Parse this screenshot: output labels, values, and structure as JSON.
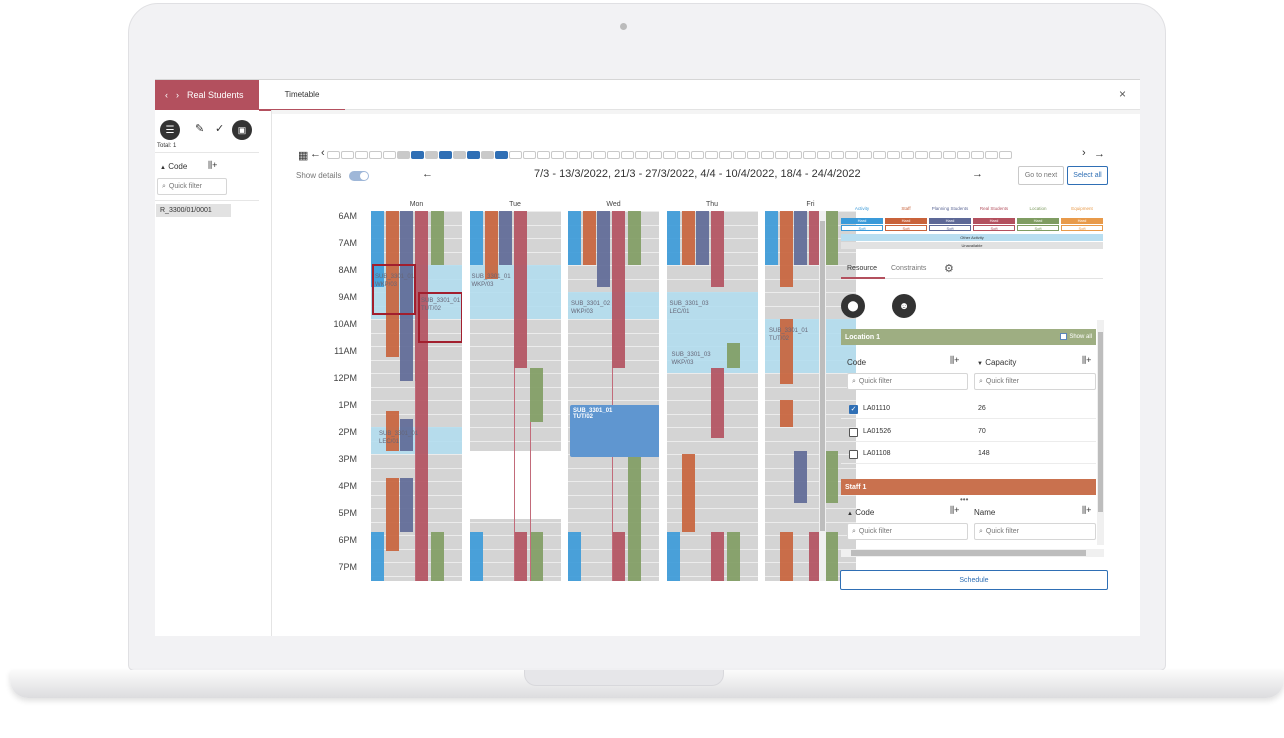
{
  "header": {
    "breadcrumb_label": "Real Students",
    "tab_label": "Timetable",
    "close_icon": "×"
  },
  "left": {
    "total": "Total: 1",
    "code_header": "Code",
    "filter_placeholder": "Quick filter",
    "rows": [
      "R_3300/01/0001"
    ]
  },
  "toolbar": {
    "date_range": "7/3 - 13/3/2022, 21/3 - 27/3/2022, 4/4 - 10/4/2022, 18/4 - 24/4/2022",
    "show_details": "Show details",
    "go_to_next": "Go to next",
    "select_all": "Select all",
    "week_states": [
      0,
      0,
      0,
      0,
      0,
      1,
      2,
      1,
      2,
      1,
      2,
      1,
      2,
      0,
      0,
      0,
      0,
      0,
      0,
      0,
      0,
      0,
      0,
      0,
      0,
      0,
      0,
      0,
      0,
      0,
      0,
      0,
      0,
      0,
      0,
      0,
      0,
      0,
      0,
      0,
      0,
      0,
      0,
      0,
      0,
      0,
      0,
      0,
      0
    ]
  },
  "calendar": {
    "days": [
      "Mon",
      "Tue",
      "Wed",
      "Thu",
      "Fri"
    ],
    "hours": [
      "6AM",
      "7AM",
      "8AM",
      "9AM",
      "10AM",
      "11AM",
      "12PM",
      "1PM",
      "2PM",
      "3PM",
      "4PM",
      "5PM",
      "6PM",
      "7PM"
    ],
    "events": [
      {
        "line1": "SUB_3301_01",
        "line2": "LEC/01"
      },
      {
        "line1": "SUB_3301_01",
        "line2": "TUT/02"
      },
      {
        "line1": "SUB_3301_01",
        "line2": "WKP/03"
      },
      {
        "line1": "SUB_3301_02",
        "line2": "LEC/01"
      },
      {
        "line1": "SUB_3301_02",
        "line2": "WKP/03"
      },
      {
        "line1": "SUB_3301_02",
        "line2": "TUT/02"
      },
      {
        "line1": "SUB_3301_03",
        "line2": "LEC/01"
      },
      {
        "line1": "SUB_3301_03",
        "line2": "WKP/03"
      },
      {
        "line1": "SUB_3301_01",
        "line2": "TUT/02"
      }
    ]
  },
  "legend": {
    "columns": [
      {
        "name": "Activity",
        "color": "#3a9ad9"
      },
      {
        "name": "Staff",
        "color": "#c8623a"
      },
      {
        "name": "Planning Students",
        "color": "#5d6896"
      },
      {
        "name": "Real Students",
        "color": "#b3505e"
      },
      {
        "name": "Location",
        "color": "#7f9c62"
      },
      {
        "name": "Equipment",
        "color": "#e89a4a"
      }
    ],
    "hard": "Hard",
    "soft": "Soft",
    "other_activity": "Other Activity",
    "unavailable": "Unavailable"
  },
  "right": {
    "tabs": [
      "Resource",
      "Constraints"
    ],
    "location_panel": "Location 1",
    "show_all": "Show all",
    "code": "Code",
    "capacity": "Capacity",
    "name": "Name",
    "filter_placeholder": "Quick filter",
    "locations": [
      {
        "code": "LA01110",
        "capacity": "26",
        "checked": true
      },
      {
        "code": "LA01526",
        "capacity": "70",
        "checked": false
      },
      {
        "code": "LA01108",
        "capacity": "148",
        "checked": false
      }
    ],
    "staff_panel": "Staff 1",
    "schedule": "Schedule"
  },
  "colors": {
    "brand": "#b3505e",
    "activity": "#3a9ad9",
    "staff": "#c8623a",
    "planning": "#5d6896",
    "real": "#b3505e",
    "location": "#7f9c62",
    "accent": "#2f6fb5"
  }
}
